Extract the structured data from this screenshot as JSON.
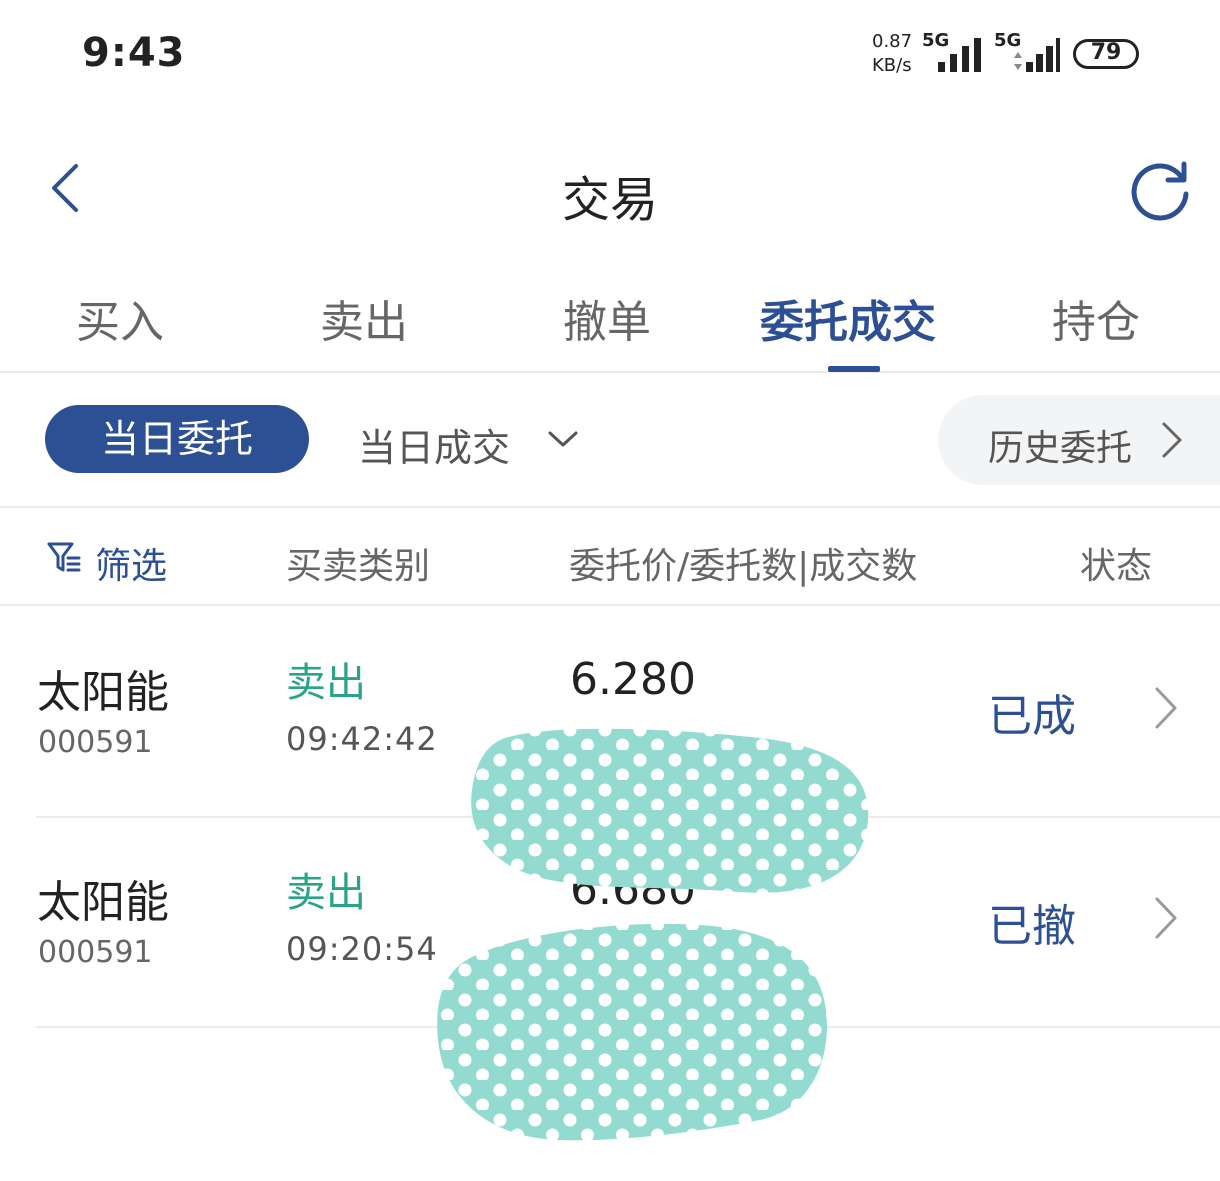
{
  "status_bar": {
    "time": "9:43",
    "net_speed_value": "0.87",
    "net_speed_unit": "KB/s",
    "sim1": "5G",
    "sim2": "5G",
    "battery": "79"
  },
  "header": {
    "title": "交易"
  },
  "tabs": [
    {
      "label": "买入"
    },
    {
      "label": "卖出"
    },
    {
      "label": "撤单"
    },
    {
      "label": "委托成交"
    },
    {
      "label": "持仓"
    }
  ],
  "subtabs": {
    "today_orders": "当日委托",
    "today_deals": "当日成交",
    "history": "历史委托"
  },
  "columns": {
    "filter": "筛选",
    "type": "买卖类别",
    "price": "委托价/委托数|成交数",
    "status": "状态"
  },
  "orders": [
    {
      "name": "太阳能",
      "code": "000591",
      "type": "卖出",
      "time": "09:42:42",
      "price": "6.280",
      "status": "已成"
    },
    {
      "name": "太阳能",
      "code": "000591",
      "type": "卖出",
      "time": "09:20:54",
      "price": "6.680",
      "status": "已撤"
    }
  ],
  "colors": {
    "accent": "#2d4f93",
    "sell_green": "#2ba38b",
    "redaction": "#93dbd0"
  }
}
